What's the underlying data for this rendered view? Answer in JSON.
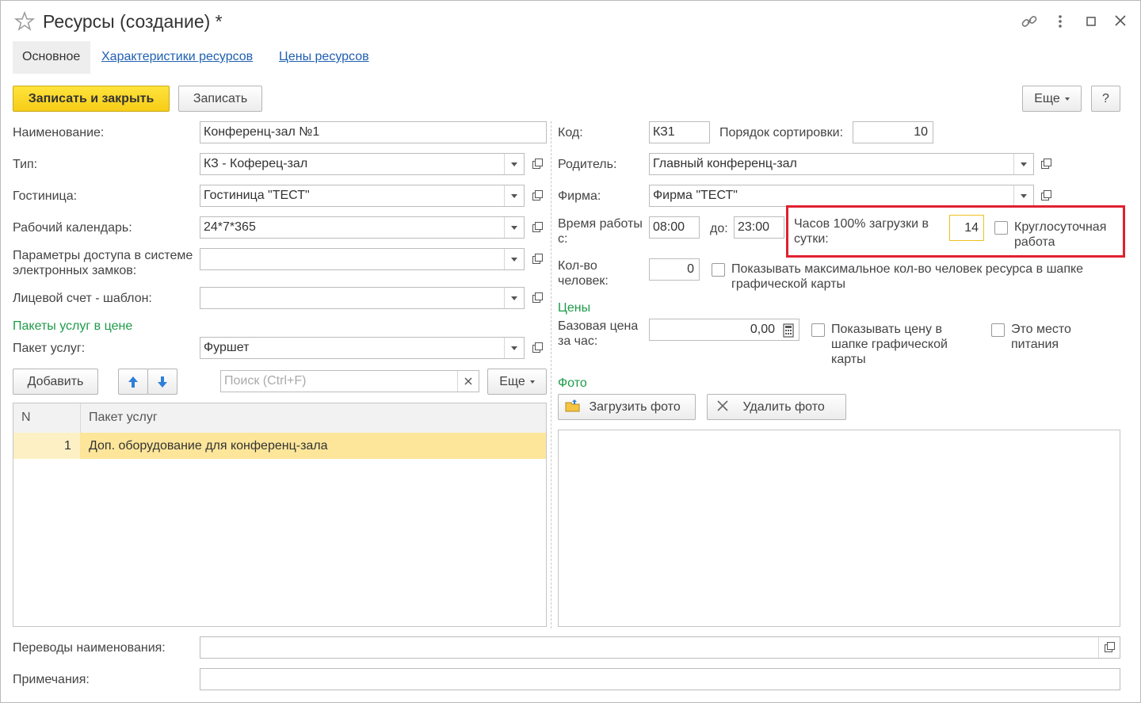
{
  "window": {
    "title": "Ресурсы (создание) *"
  },
  "tabs": {
    "main": "Основное",
    "characteristics": "Характеристики ресурсов",
    "prices": "Цены ресурсов"
  },
  "toolbar": {
    "save_close": "Записать и закрыть",
    "save": "Записать",
    "more": "Еще",
    "help": "?"
  },
  "form": {
    "name_label": "Наименование:",
    "name_value": "Конференц-зал №1",
    "type_label": "Тип:",
    "type_value": "КЗ - Коферец-зал",
    "hotel_label": "Гостиница:",
    "hotel_value": "Гостиница \"ТЕСТ\"",
    "calendar_label": "Рабочий календарь:",
    "calendar_value": "24*7*365",
    "access_label": "Параметры доступа в системе электронных замков:",
    "access_value": "",
    "account_label": "Лицевой счет - шаблон:",
    "account_value": "",
    "packages_section": "Пакеты услуг в цене",
    "package_label": "Пакет услуг:",
    "package_value": "Фуршет",
    "code_label": "Код:",
    "code_value": "КЗ1",
    "sort_label": "Порядок сортировки:",
    "sort_value": "10",
    "parent_label": "Родитель:",
    "parent_value": "Главный конференц-зал",
    "firm_label": "Фирма:",
    "firm_value": "Фирма \"ТЕСТ\"",
    "worktime_label": "Время работы с:",
    "worktime_from": "08:00",
    "to_label": "до:",
    "worktime_to": "23:00",
    "hours_label": "Часов 100% загрузки в сутки:",
    "hours_value": "14",
    "roundclock_label": "Круглосуточная работа",
    "persons_label": "Кол-во человек:",
    "persons_value": "0",
    "show_max_label": "Показывать максимальное кол-во человек ресурса в шапке графической карты",
    "prices_section": "Цены",
    "base_price_label": "Базовая цена за час:",
    "base_price_value": "0,00",
    "show_price_label": "Показывать цену в шапке графической карты",
    "food_label": "Это место питания",
    "photo_section": "Фото",
    "load_photo": "Загрузить фото",
    "delete_photo": "Удалить фото",
    "translations_label": "Переводы наименования:",
    "translations_value": "",
    "notes_label": "Примечания:",
    "notes_value": ""
  },
  "list_toolbar": {
    "add": "Добавить",
    "search_placeholder": "Поиск (Ctrl+F)",
    "more": "Еще"
  },
  "table": {
    "headers": [
      "N",
      "Пакет услуг"
    ],
    "rows": [
      {
        "n": "1",
        "package": "Доп. оборудование для конференц-зала"
      }
    ]
  },
  "colors": {
    "primary_button": "#f7cd17",
    "section_text": "#1e9b4a",
    "highlight_box": "#e0212f",
    "selected_row": "#fde69a"
  }
}
